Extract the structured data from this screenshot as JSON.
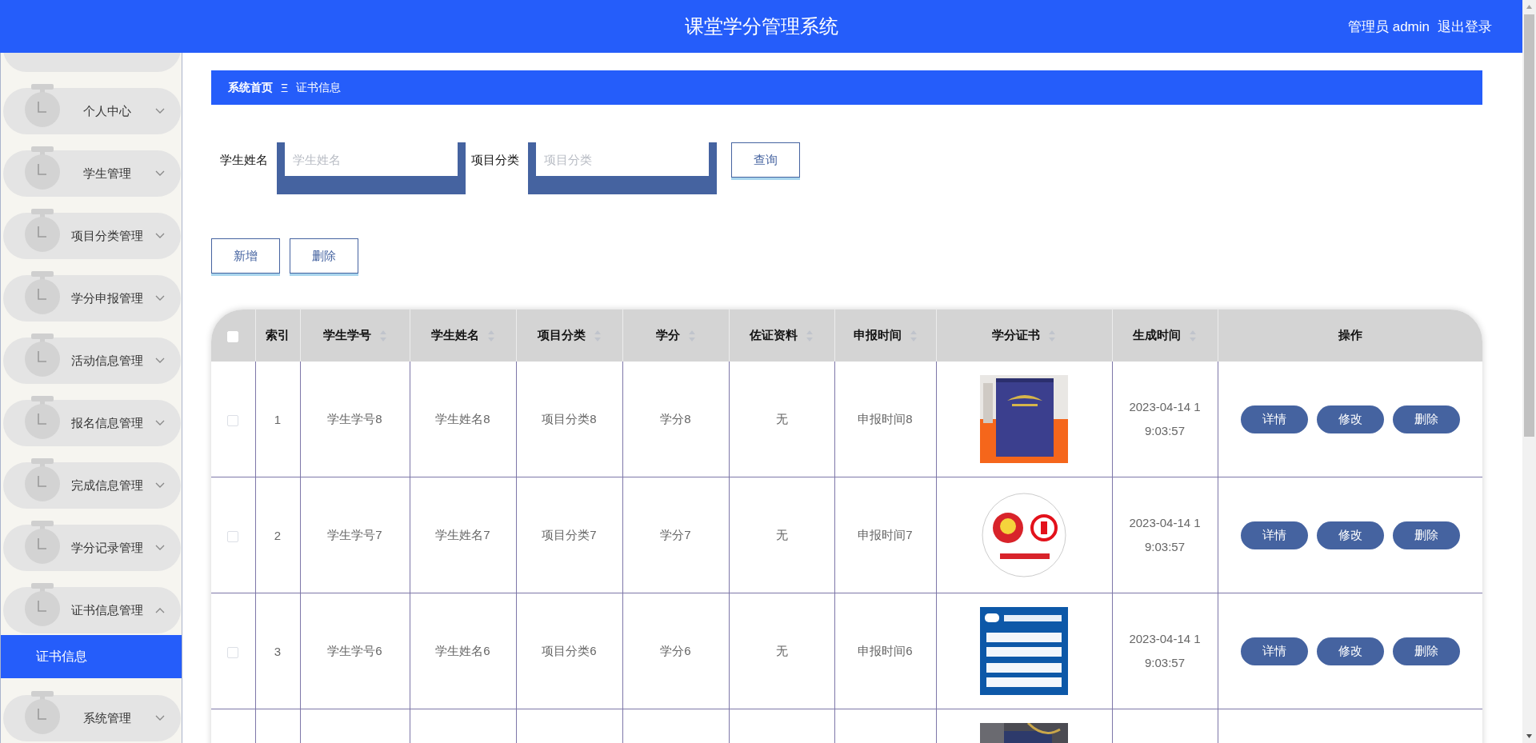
{
  "header": {
    "title": "课堂学分管理系统",
    "user": "管理员 admin",
    "logout": "退出登录"
  },
  "sidebar": {
    "items": [
      {
        "kind": "partial"
      },
      {
        "kind": "menu",
        "label": "个人中心",
        "expanded": false
      },
      {
        "kind": "menu",
        "label": "学生管理",
        "expanded": false
      },
      {
        "kind": "menu",
        "label": "项目分类管理",
        "expanded": false
      },
      {
        "kind": "menu",
        "label": "学分申报管理",
        "expanded": false
      },
      {
        "kind": "menu",
        "label": "活动信息管理",
        "expanded": false
      },
      {
        "kind": "menu",
        "label": "报名信息管理",
        "expanded": false
      },
      {
        "kind": "menu",
        "label": "完成信息管理",
        "expanded": false
      },
      {
        "kind": "menu",
        "label": "学分记录管理",
        "expanded": false
      },
      {
        "kind": "menu",
        "label": "证书信息管理",
        "expanded": true,
        "children": [
          {
            "label": "证书信息",
            "selected": true
          }
        ]
      },
      {
        "kind": "menu",
        "label": "系统管理",
        "expanded": false
      }
    ]
  },
  "breadcrumb": {
    "home": "系统首页",
    "separator": "Ξ",
    "current": "证书信息"
  },
  "search": {
    "fields": [
      {
        "label": "学生姓名",
        "placeholder": "学生姓名"
      },
      {
        "label": "项目分类",
        "placeholder": "项目分类"
      }
    ],
    "button": "查询"
  },
  "actions": [
    "新增",
    "删除"
  ],
  "table": {
    "select_all_checked": false,
    "columns": [
      {
        "label": "索引",
        "sortable": false
      },
      {
        "label": "学生学号",
        "sortable": true
      },
      {
        "label": "学生姓名",
        "sortable": true
      },
      {
        "label": "项目分类",
        "sortable": true
      },
      {
        "label": "学分",
        "sortable": true
      },
      {
        "label": "佐证资料",
        "sortable": true
      },
      {
        "label": "申报时间",
        "sortable": true
      },
      {
        "label": "学分证书",
        "sortable": true
      },
      {
        "label": "生成时间",
        "sortable": true
      },
      {
        "label": "操作",
        "sortable": false
      }
    ],
    "rows": [
      {
        "checked": false,
        "cells": [
          "1",
          "学生学号8",
          "学生姓名8",
          "项目分类8",
          "学分8",
          "无",
          "申报时间8"
        ],
        "certificate": {
          "kind": "picture"
        },
        "created": "2023-04-14 19:03:57",
        "actions": [
          "详情",
          "修改",
          "删除"
        ]
      },
      {
        "checked": false,
        "cells": [
          "2",
          "学生学号7",
          "学生姓名7",
          "项目分类7",
          "学分7",
          "无",
          "申报时间7"
        ],
        "certificate": {
          "kind": "picture"
        },
        "created": "2023-04-14 19:03:57",
        "actions": [
          "详情",
          "修改",
          "删除"
        ]
      },
      {
        "checked": false,
        "cells": [
          "3",
          "学生学号6",
          "学生姓名6",
          "项目分类6",
          "学分6",
          "无",
          "申报时间6"
        ],
        "certificate": {
          "kind": "picture"
        },
        "created": "2023-04-14 19:03:57",
        "actions": [
          "详情",
          "修改",
          "删除"
        ]
      },
      {
        "certificate": {
          "kind": "picture"
        }
      }
    ]
  }
}
